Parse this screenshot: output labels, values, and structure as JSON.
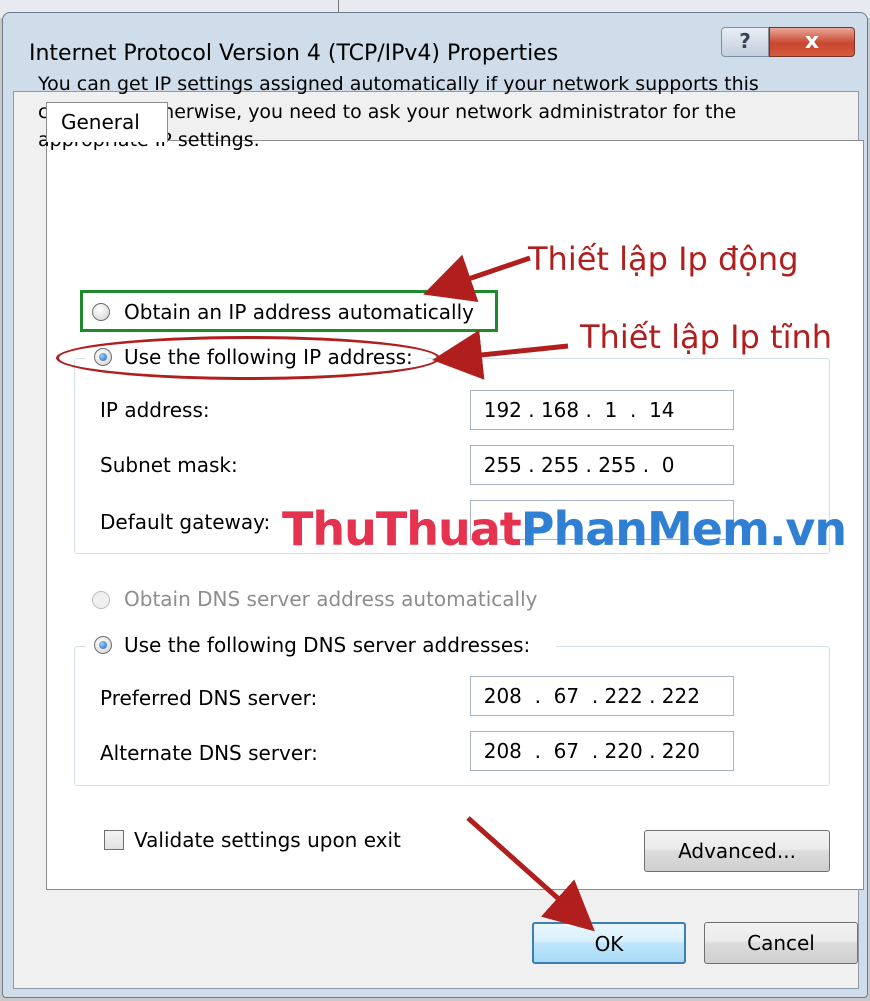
{
  "window": {
    "title": "Internet Protocol Version 4 (TCP/IPv4) Properties",
    "help_label": "?",
    "close_label": "x"
  },
  "tab": {
    "label": "General"
  },
  "intro_text": "You can get IP settings assigned automatically if your network supports this capability. Otherwise, you need to ask your network administrator for the appropriate IP settings.",
  "ip": {
    "auto_label": "Obtain an IP address automatically",
    "manual_label": "Use the following IP address:",
    "selected": "manual",
    "fields": [
      {
        "label": "IP address:",
        "value": "  192 . 168 .  1  .  14"
      },
      {
        "label": "Subnet mask:",
        "value": "  255 . 255 . 255 .  0"
      },
      {
        "label": "Default gateway:",
        "value": ""
      }
    ]
  },
  "dns": {
    "auto_label": "Obtain DNS server address automatically",
    "manual_label": "Use the following DNS server addresses:",
    "selected": "manual",
    "fields": [
      {
        "label": "Preferred DNS server:",
        "value": "  208  .  67  . 222 . 222"
      },
      {
        "label": "Alternate DNS server:",
        "value": "  208  .  67  . 220 . 220"
      }
    ]
  },
  "validate_label": "Validate settings upon exit",
  "buttons": {
    "advanced": "Advanced...",
    "ok": "OK",
    "cancel": "Cancel"
  },
  "annotations": {
    "dynamic_ip": "Thiết lập Ip động",
    "static_ip": "Thiết lập Ip tĩnh"
  },
  "watermark": {
    "part1": "ThuThuat",
    "part2": "PhanMem",
    "part3": ".vn"
  },
  "colors": {
    "annotation": "#b01e1e",
    "green_box": "#1f8a2d",
    "watermark_red": "#e5324f",
    "watermark_blue": "#2f7fd3"
  }
}
